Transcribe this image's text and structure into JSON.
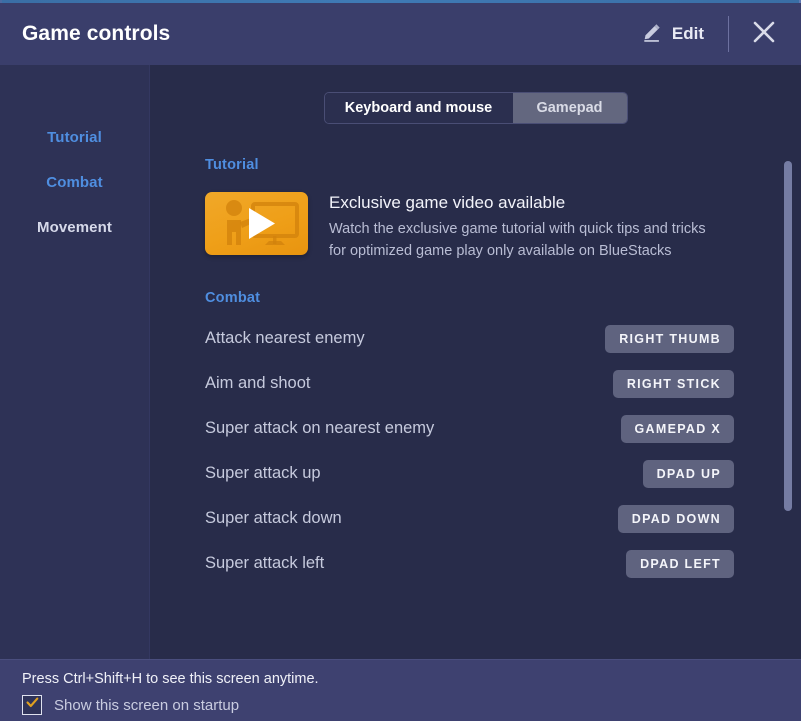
{
  "window": {
    "title": "Game controls"
  },
  "header": {
    "edit_label": "Edit",
    "edit_icon": "pencil-icon",
    "close_icon": "close-icon"
  },
  "sidebar": {
    "items": [
      {
        "label": "Tutorial",
        "style": "link"
      },
      {
        "label": "Combat",
        "style": "link"
      },
      {
        "label": "Movement",
        "style": "plain"
      }
    ]
  },
  "input_toggle": {
    "options": [
      {
        "label": "Keyboard and mouse",
        "selected": true
      },
      {
        "label": "Gamepad",
        "selected": false
      }
    ]
  },
  "sections": {
    "tutorial": {
      "title": "Tutorial",
      "card": {
        "icon": "video-tutorial-icon",
        "heading": "Exclusive game video available",
        "description": "Watch the exclusive game tutorial with quick tips and tricks for optimized game play only available on BlueStacks"
      }
    },
    "combat": {
      "title": "Combat",
      "rows": [
        {
          "action": "Attack nearest enemy",
          "key": "RIGHT THUMB"
        },
        {
          "action": "Aim and shoot",
          "key": "RIGHT STICK"
        },
        {
          "action": "Super attack on nearest enemy",
          "key": "GAMEPAD X"
        },
        {
          "action": "Super attack up",
          "key": "DPAD UP"
        },
        {
          "action": "Super attack down",
          "key": "DPAD DOWN"
        },
        {
          "action": "Super attack left",
          "key": "DPAD LEFT"
        }
      ]
    }
  },
  "footer": {
    "hint": "Press Ctrl+Shift+H to see this screen anytime.",
    "checkbox_label": "Show this screen on startup",
    "checkbox_checked": true
  },
  "colors": {
    "accent_link": "#4f8ee0",
    "header_bg": "#3a3e6b",
    "panel_bg": "#282c4a",
    "sidebar_bg": "#2e3256",
    "footer_bg": "#3e4170",
    "key_badge_bg": "#5f637f",
    "video_orange": "#ef9f18",
    "check_orange": "#e0a020"
  }
}
